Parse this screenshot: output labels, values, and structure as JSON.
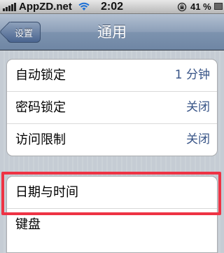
{
  "status_bar": {
    "carrier": "AppZD.net",
    "time": "2:02",
    "battery": "41 %",
    "icons": [
      "signal-icon",
      "wifi-icon",
      "rotation-lock-icon",
      "battery-icon"
    ]
  },
  "nav": {
    "back_label": "设置",
    "title": "通用"
  },
  "group1": [
    {
      "label": "自动锁定",
      "value": "1 分钟"
    },
    {
      "label": "密码锁定",
      "value": "关闭"
    },
    {
      "label": "访问限制",
      "value": "关闭"
    }
  ],
  "group2": [
    {
      "label": "日期与时间"
    },
    {
      "label": "键盘"
    }
  ],
  "colors": {
    "nav_bar": "#7d93af",
    "value_text": "#385487",
    "highlight": "#ee3344",
    "background": "#c5ccd4"
  }
}
